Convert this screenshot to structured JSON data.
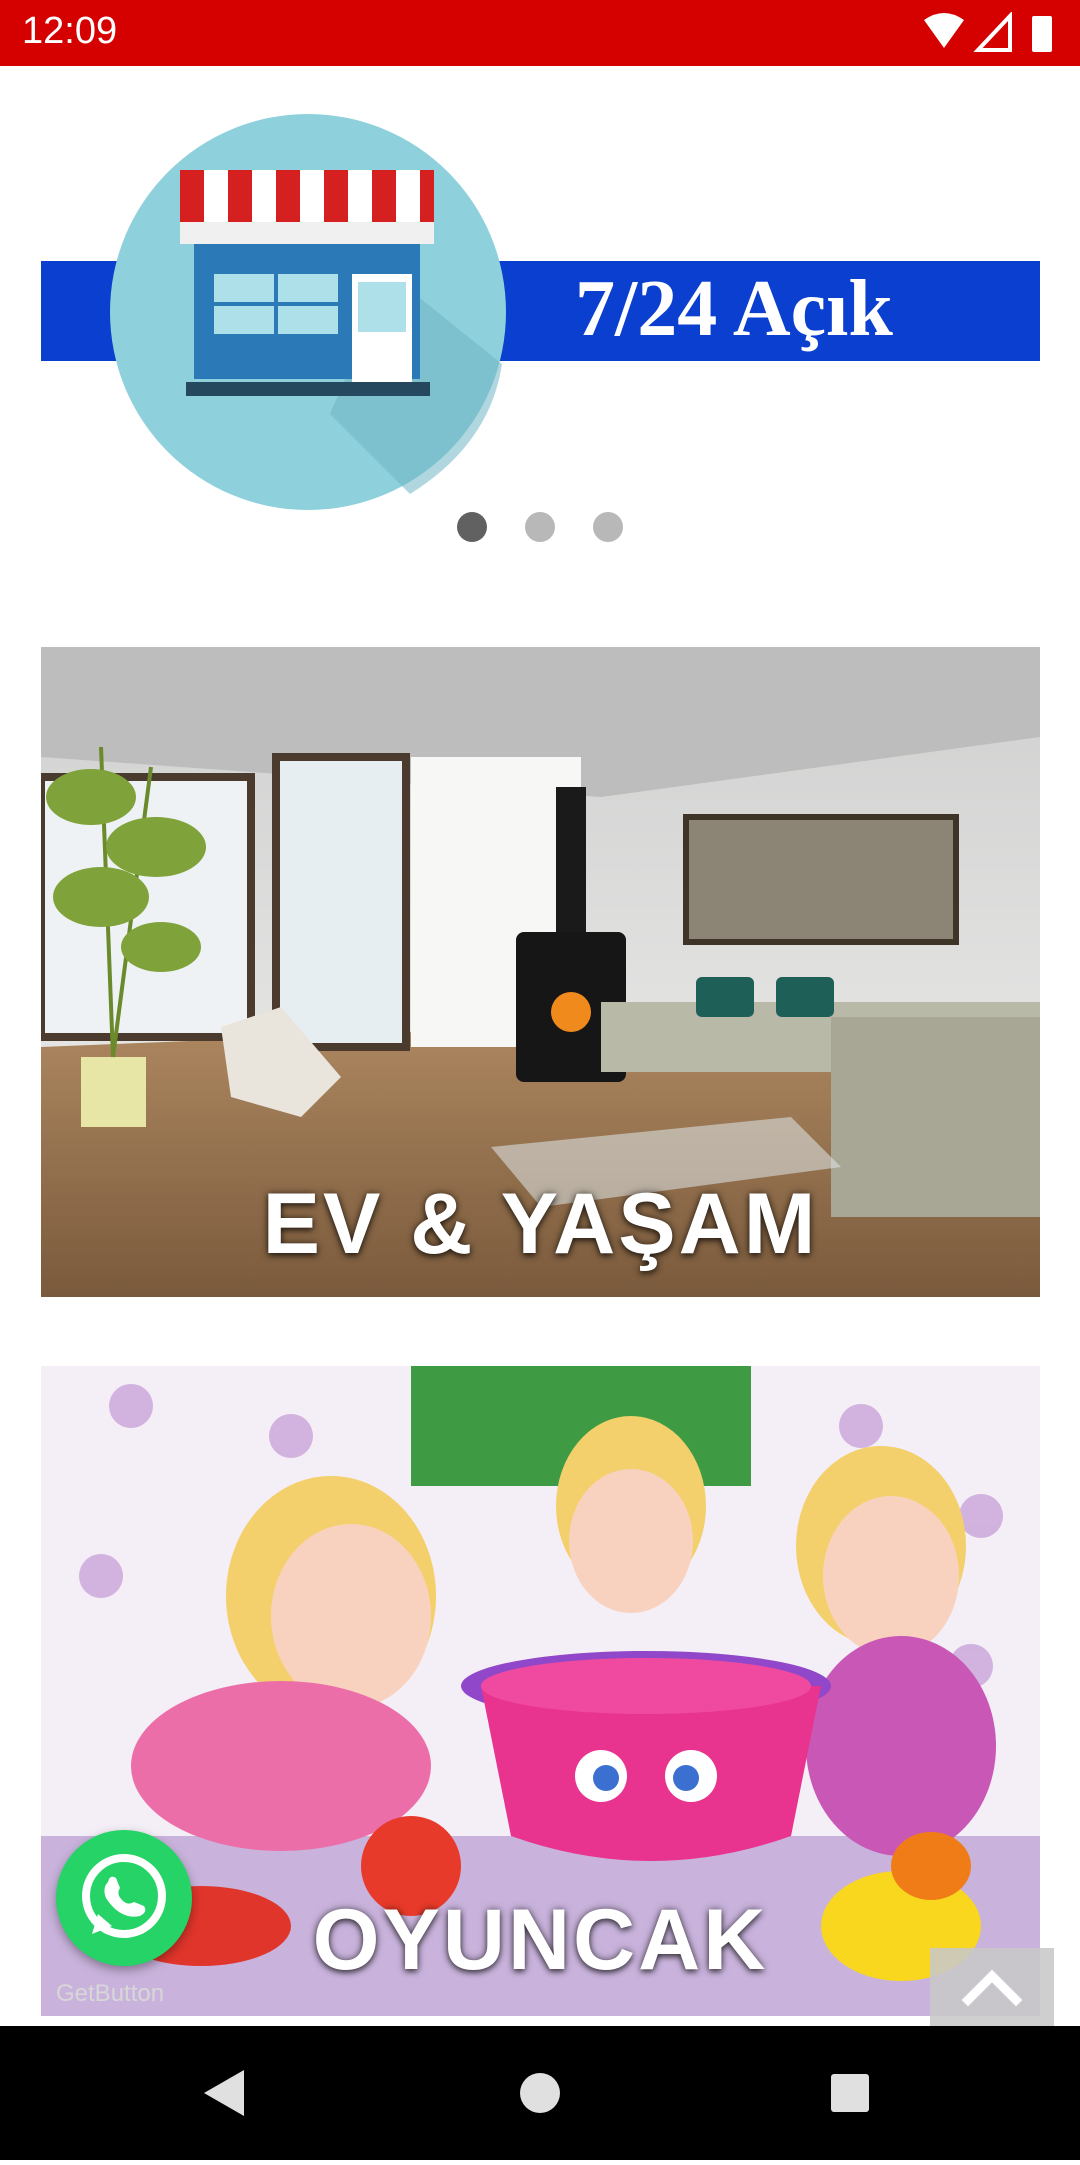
{
  "status_bar": {
    "time": "12:09",
    "icons": [
      "wifi-icon",
      "signal-icon",
      "battery-icon"
    ],
    "color": "#d50000"
  },
  "banner": {
    "text": "7/24 Açık",
    "strip_color": "#0a3fcf",
    "icon": "store-icon",
    "carousel": {
      "slide_count": 3,
      "active_slide": 1
    }
  },
  "categories": [
    {
      "label": "EV & YAŞAM",
      "image": "living-room-photo"
    },
    {
      "label": "OYUNCAK",
      "image": "toy-dolls-photo"
    }
  ],
  "floating": {
    "whatsapp_icon": "whatsapp-icon",
    "watermark": "GetButton",
    "scroll_top_icon": "chevron-up-icon"
  },
  "nav_bar": {
    "icons": [
      "back-icon",
      "home-icon",
      "recents-icon"
    ]
  }
}
